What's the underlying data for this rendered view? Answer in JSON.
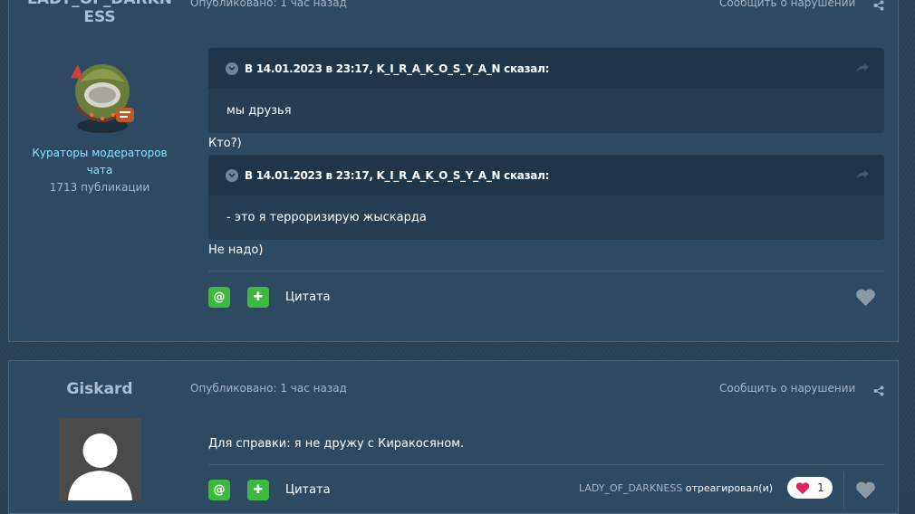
{
  "post1": {
    "author": {
      "name_line1": "LADY_OF_DARKN",
      "name_line2": "ESS",
      "role_line1": "Кураторы модераторов",
      "role_line2": "чата",
      "post_count": "1713 публикации"
    },
    "published": "Опубликовано: 1 час назад",
    "report": "Сообщить о нарушении",
    "quotes": [
      {
        "header": "В 14.01.2023 в 23:17, K_I_R_A_K_O_S_Y_A_N сказал:",
        "body": "мы друзья"
      },
      {
        "header": "В 14.01.2023 в 23:17, K_I_R_A_K_O_S_Y_A_N сказал:",
        "body": "- это я терроризирую жыскарда"
      }
    ],
    "reply1": "Кто?)",
    "reply2": "Не надо)",
    "mention_symbol": "@",
    "plus_symbol": "✚",
    "quote_label": "Цитата"
  },
  "post2": {
    "author": {
      "name": "Giskard"
    },
    "published": "Опубликовано: 1 час назад",
    "report": "Сообщить о нарушении",
    "text": "Для справки: я не дружу с Киракосяном.",
    "mention_symbol": "@",
    "plus_symbol": "✚",
    "quote_label": "Цитата",
    "reaction_user": "LADY_OF_DARKNESS",
    "reaction_text": "отреагировал(и)",
    "reaction_count": "1"
  },
  "colors": {
    "accent_green": "#3fb83f",
    "panel": "#2e4a63",
    "quote_head": "#1f3549",
    "role_color": "#8fe0ff"
  }
}
